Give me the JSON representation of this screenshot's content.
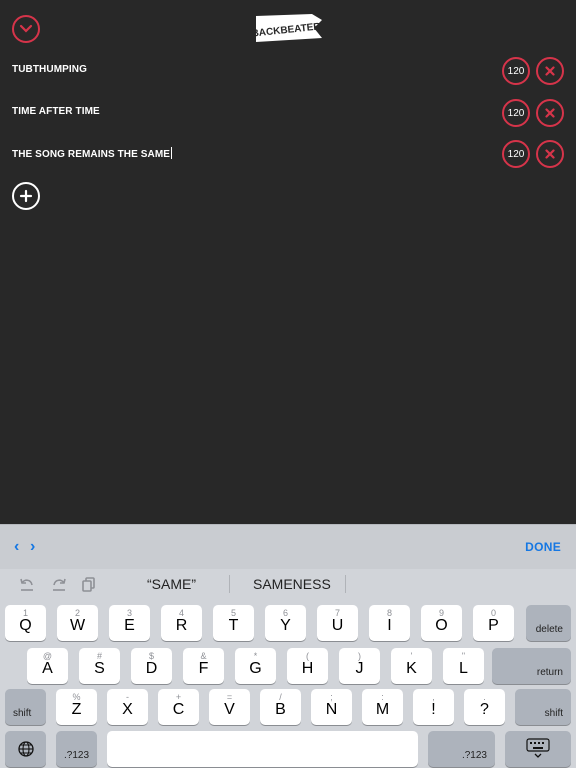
{
  "app": {
    "logo_text": "BACKBEATER",
    "songs": [
      {
        "title": "TUBTHUMPING",
        "bpm": "120"
      },
      {
        "title": "TIME AFTER TIME",
        "bpm": "120"
      },
      {
        "title": "THE SONG REMAINS THE SAME",
        "bpm": "120"
      }
    ]
  },
  "keyboard": {
    "accessory": {
      "prev": "‹",
      "next": "›",
      "done": "DONE"
    },
    "suggestions": [
      "“SAME”",
      "SAMENESS"
    ],
    "row1": [
      {
        "main": "Q",
        "alt": "1"
      },
      {
        "main": "W",
        "alt": "2"
      },
      {
        "main": "E",
        "alt": "3"
      },
      {
        "main": "R",
        "alt": "4"
      },
      {
        "main": "T",
        "alt": "5"
      },
      {
        "main": "Y",
        "alt": "6"
      },
      {
        "main": "U",
        "alt": "7"
      },
      {
        "main": "I",
        "alt": "8"
      },
      {
        "main": "O",
        "alt": "9"
      },
      {
        "main": "P",
        "alt": "0"
      }
    ],
    "row2": [
      {
        "main": "A",
        "alt": "@"
      },
      {
        "main": "S",
        "alt": "#"
      },
      {
        "main": "D",
        "alt": "$"
      },
      {
        "main": "F",
        "alt": "&"
      },
      {
        "main": "G",
        "alt": "*"
      },
      {
        "main": "H",
        "alt": "("
      },
      {
        "main": "J",
        "alt": ")"
      },
      {
        "main": "K",
        "alt": "'"
      },
      {
        "main": "L",
        "alt": "\""
      }
    ],
    "row3": [
      {
        "main": "Z",
        "alt": "%"
      },
      {
        "main": "X",
        "alt": "-"
      },
      {
        "main": "C",
        "alt": "+"
      },
      {
        "main": "V",
        "alt": "="
      },
      {
        "main": "B",
        "alt": "/"
      },
      {
        "main": "N",
        "alt": ";"
      },
      {
        "main": "M",
        "alt": ":"
      },
      {
        "main": "!",
        "alt": ","
      },
      {
        "main": "?",
        "alt": "."
      }
    ],
    "delete": "delete",
    "return": "return",
    "shift": "shift",
    "numbers": ".?123"
  },
  "colors": {
    "accent_red": "#d6344a",
    "background": "#282828",
    "link_blue": "#1577e3"
  }
}
